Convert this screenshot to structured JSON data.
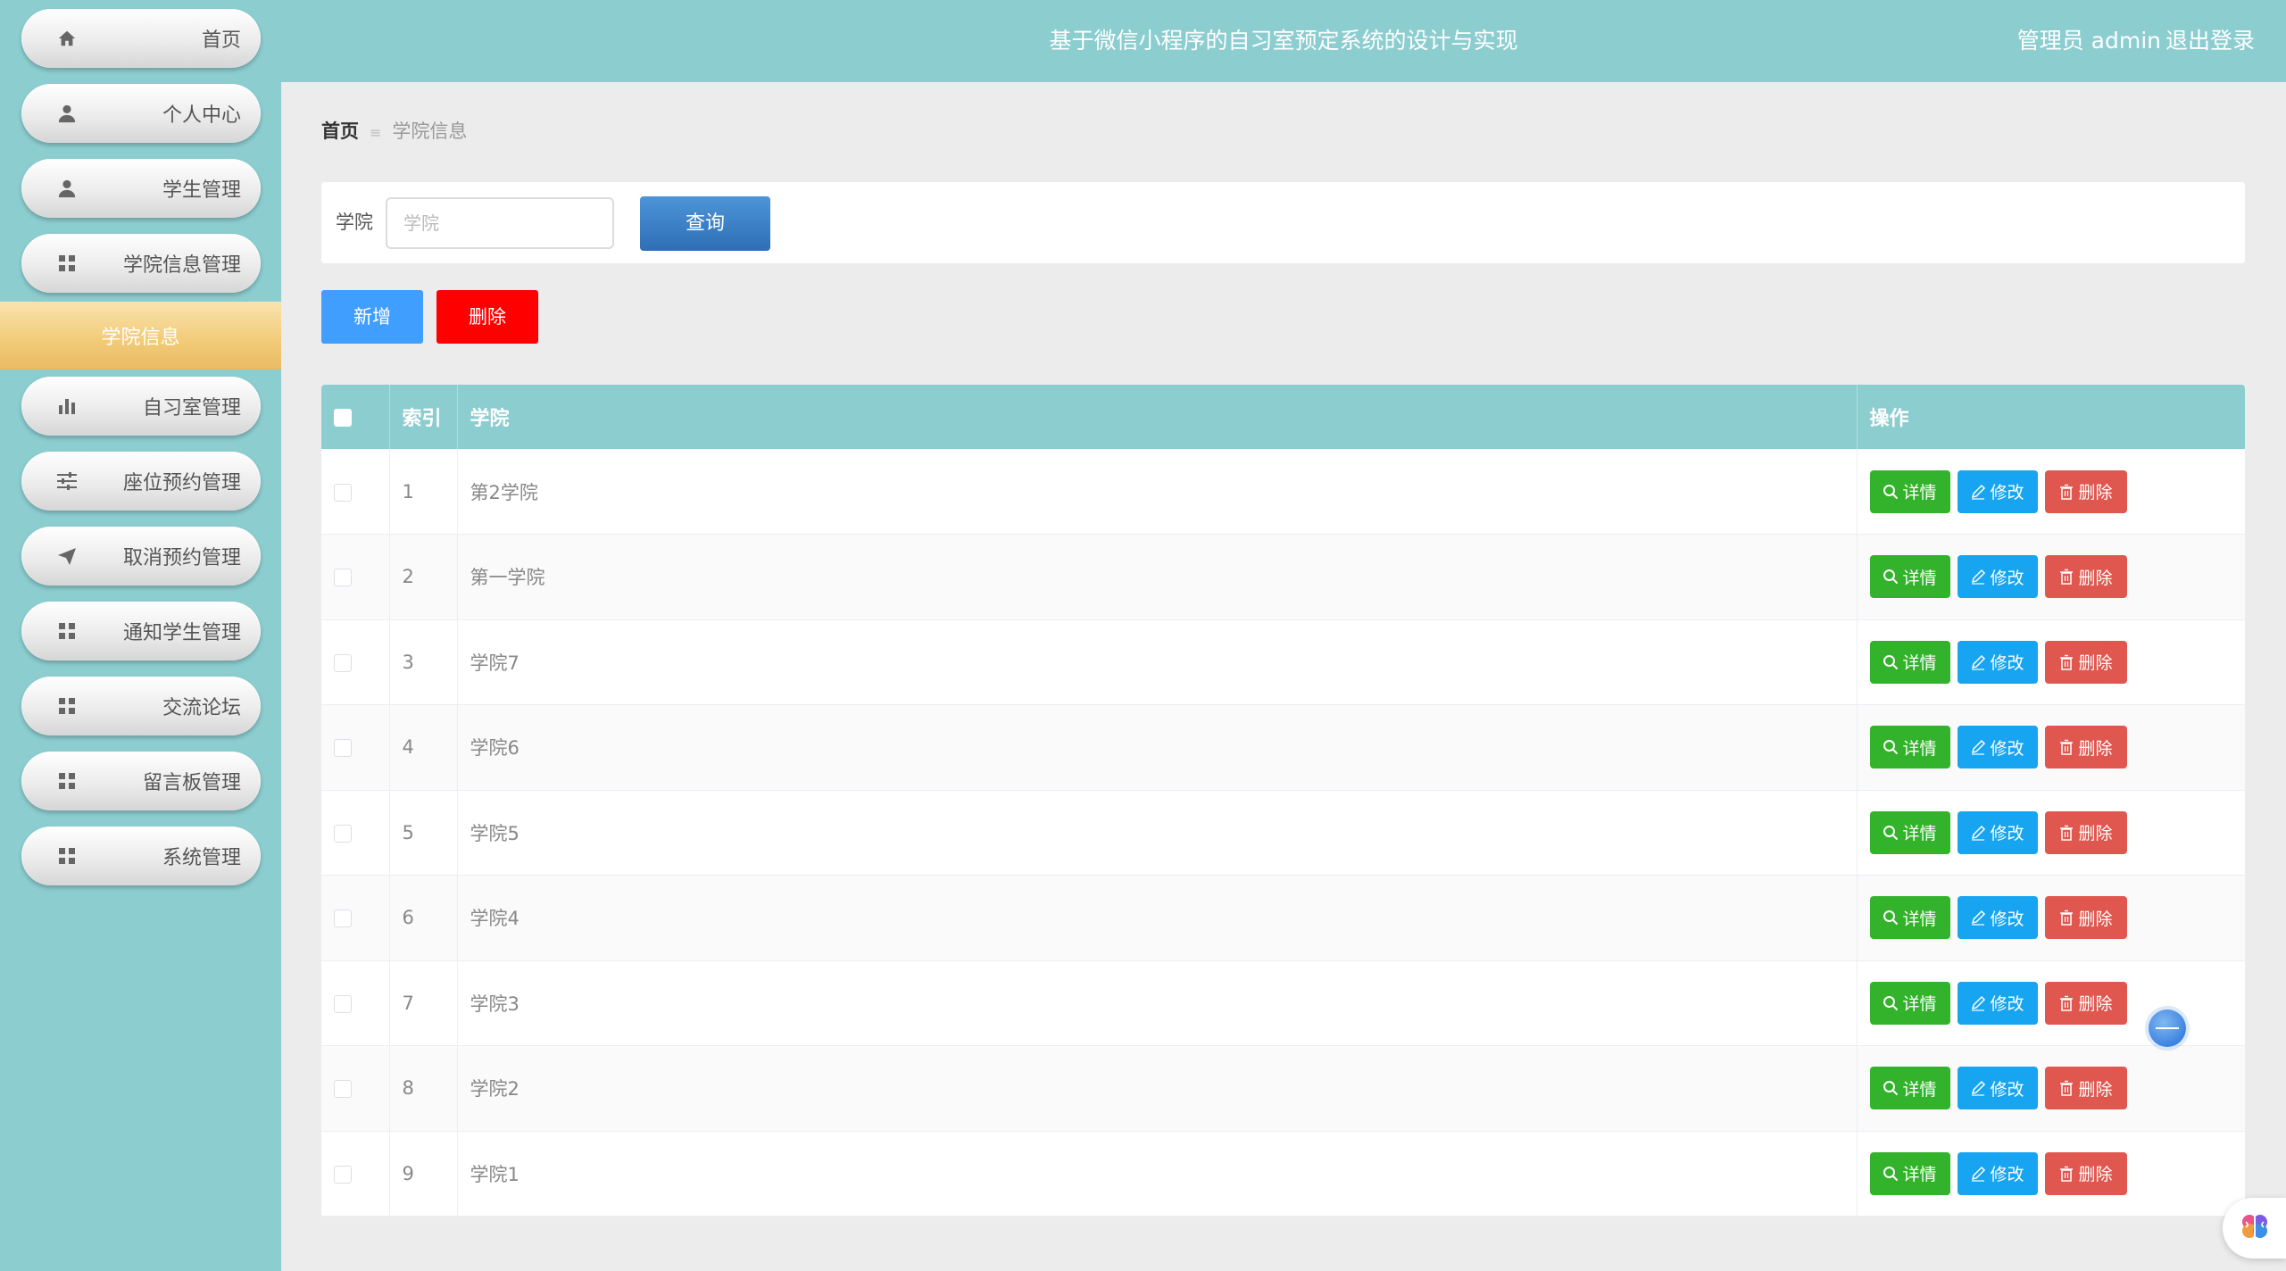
{
  "app": {
    "title": "基于微信小程序的自习室预定系统的设计与实现",
    "user_label": "管理员 admin",
    "logout_label": "退出登录"
  },
  "sidebar": {
    "items": [
      {
        "label": "首页",
        "icon": "home-icon"
      },
      {
        "label": "个人中心",
        "icon": "user-icon"
      },
      {
        "label": "学生管理",
        "icon": "user-icon"
      },
      {
        "label": "学院信息管理",
        "icon": "grid-icon"
      },
      {
        "label": "自习室管理",
        "icon": "bar-chart-icon"
      },
      {
        "label": "座位预约管理",
        "icon": "sliders-icon"
      },
      {
        "label": "取消预约管理",
        "icon": "send-icon"
      },
      {
        "label": "通知学生管理",
        "icon": "grid-icon"
      },
      {
        "label": "交流论坛",
        "icon": "grid-icon"
      },
      {
        "label": "留言板管理",
        "icon": "grid-icon"
      },
      {
        "label": "系统管理",
        "icon": "grid-icon"
      }
    ],
    "active_sub": "学院信息"
  },
  "breadcrumb": {
    "home": "首页",
    "separator": "≡",
    "current": "学院信息"
  },
  "search": {
    "label": "学院",
    "placeholder": "学院",
    "value": "",
    "button": "查询"
  },
  "actions": {
    "add": "新增",
    "delete": "删除"
  },
  "table": {
    "columns": [
      "索引",
      "学院",
      "操作"
    ],
    "rows": [
      {
        "index": "1",
        "college": "第2学院"
      },
      {
        "index": "2",
        "college": "第一学院"
      },
      {
        "index": "3",
        "college": "学院7"
      },
      {
        "index": "4",
        "college": "学院6"
      },
      {
        "index": "5",
        "college": "学院5"
      },
      {
        "index": "6",
        "college": "学院4"
      },
      {
        "index": "7",
        "college": "学院3"
      },
      {
        "index": "8",
        "college": "学院2"
      },
      {
        "index": "9",
        "college": "学院1"
      }
    ],
    "row_actions": {
      "detail": "详情",
      "edit": "修改",
      "delete": "删除"
    }
  },
  "colors": {
    "theme": "#8ccdd0",
    "active_menu": "#f2ca77",
    "query_button": "#2f6fb4",
    "add_button": "#409eff",
    "delete_button": "#ff0000",
    "detail_button": "#33b22b",
    "edit_button": "#17a4f0",
    "row_delete_button": "#e0574f"
  }
}
